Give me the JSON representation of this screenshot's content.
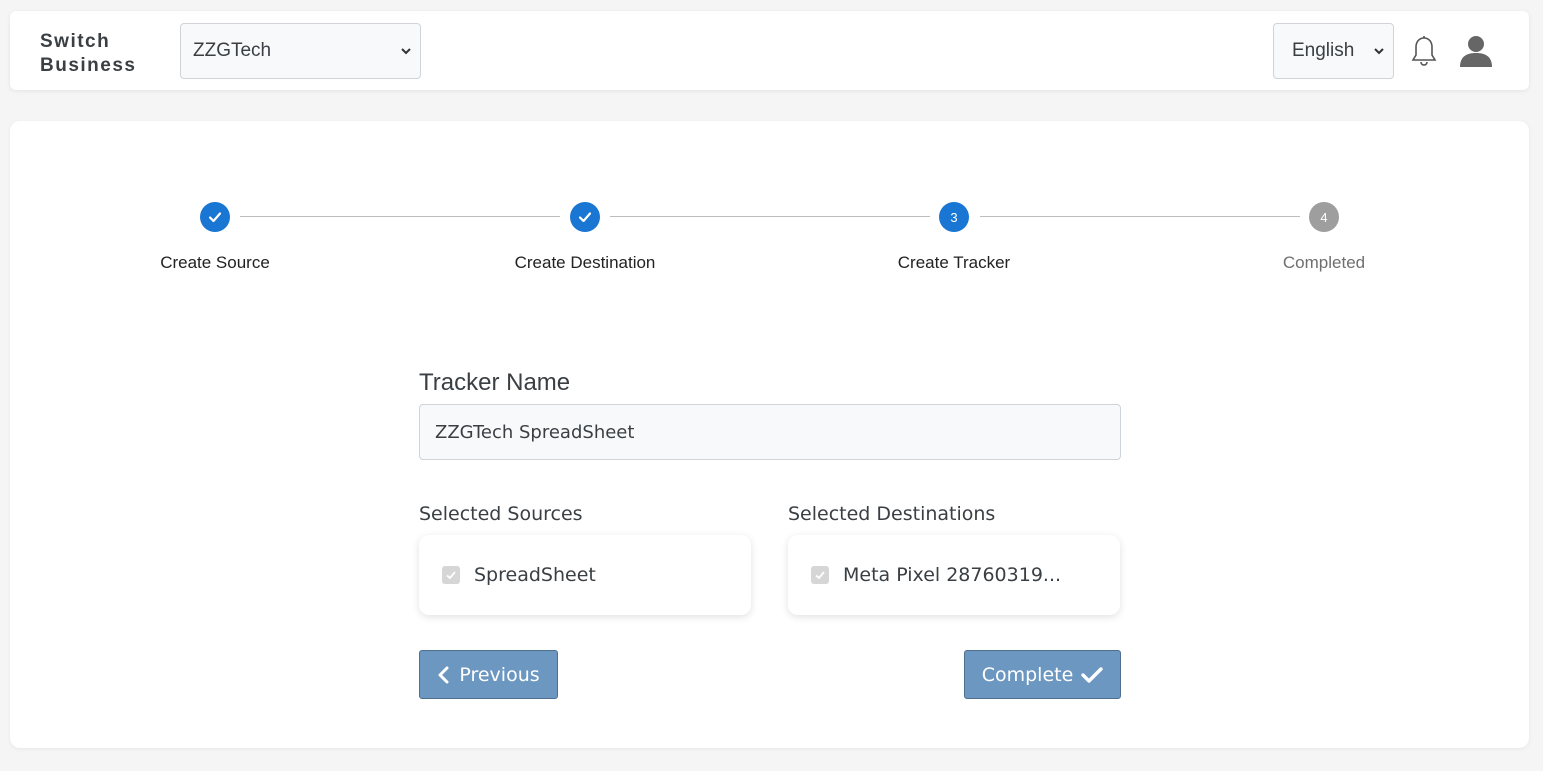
{
  "header": {
    "brand_line1": "Switch",
    "brand_line2": "Business",
    "business_select": "ZZGTech",
    "language_select": "English"
  },
  "stepper": {
    "steps": [
      {
        "label": "Create Source",
        "number": "1",
        "status": "done"
      },
      {
        "label": "Create Destination",
        "number": "2",
        "status": "done"
      },
      {
        "label": "Create Tracker",
        "number": "3",
        "status": "active"
      },
      {
        "label": "Completed",
        "number": "4",
        "status": "pending"
      }
    ]
  },
  "form": {
    "tracker_name_label": "Tracker Name",
    "tracker_name_value": "ZZGTech SpreadSheet",
    "sources_label": "Selected Sources",
    "destinations_label": "Selected Destinations",
    "source_item": "SpreadSheet",
    "destination_item": "Meta Pixel 28760319..."
  },
  "actions": {
    "previous_label": "Previous",
    "complete_label": "Complete"
  },
  "colors": {
    "primary": "#1976d2",
    "button": "#6c97c1",
    "pending": "#9e9e9e"
  }
}
